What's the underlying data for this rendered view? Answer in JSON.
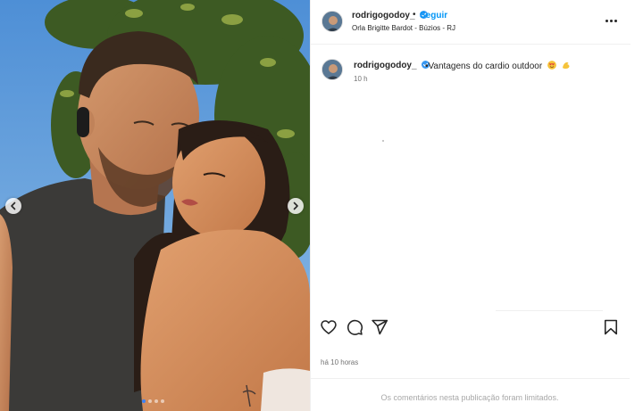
{
  "post": {
    "username": "rodrigogodoy_",
    "verified": true,
    "separator": "•",
    "follow_label": "Seguir",
    "location": "Orla Brigitte Bardot - Búzios - RJ",
    "caption": "•Vantagens do cardio outdoor",
    "caption_emojis": [
      "smiling-face-with-heart-eyes",
      "flexed-biceps"
    ],
    "caption_time": "10 h",
    "posted_ago": "há 10 horas",
    "comments_limited_text": "Os comentários nesta publicação foram limitados."
  },
  "carousel": {
    "total_slides": 4,
    "active_index": 0
  },
  "icons": {
    "more": "more-options-icon",
    "like": "heart-icon",
    "comment": "comment-icon",
    "share": "share-icon",
    "save": "bookmark-icon",
    "verified": "verified-badge-icon",
    "prev": "chevron-left-icon",
    "next": "chevron-right-icon"
  },
  "colors": {
    "link_blue": "#0095f6",
    "verified_blue": "#3897f0",
    "text": "#262626",
    "muted": "#737373",
    "divider": "#efefef"
  }
}
